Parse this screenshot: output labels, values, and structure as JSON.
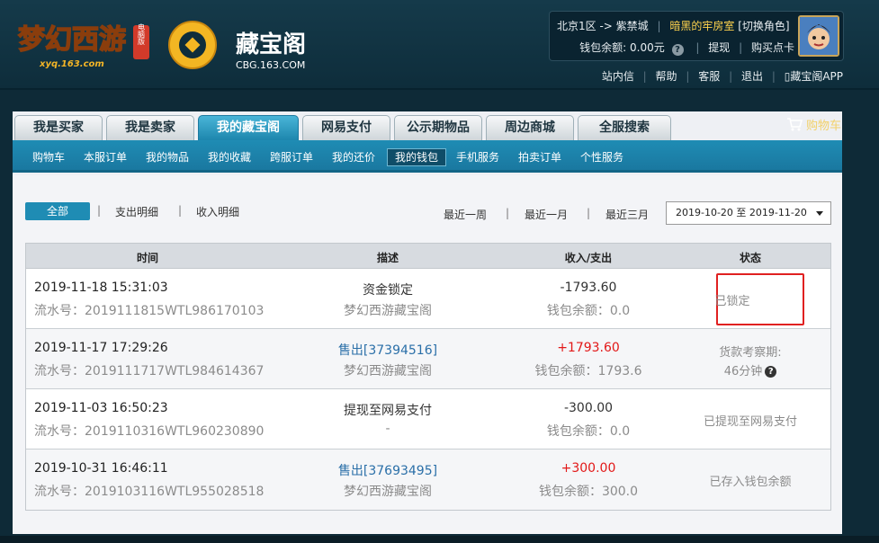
{
  "header": {
    "game_logo_text": "梦幻西游",
    "game_logo_badge": "电脑版",
    "game_logo_url": "xyq.163.com",
    "cbg_logo_text": "藏宝阁",
    "cbg_logo_url": "CBG.163.COM",
    "server": "北京1区 -> 紫禁城",
    "role_name": "暗黑的牢房室",
    "switch_role": "[切换角色]",
    "wallet_label": "钱包余额:",
    "wallet_value": "0.00元",
    "withdraw": "提现",
    "buy_card": "购买点卡",
    "top_links": [
      "站内信",
      "帮助",
      "客服",
      "退出",
      "藏宝阁APP"
    ]
  },
  "primary_nav": [
    "我是买家",
    "我是卖家",
    "我的藏宝阁",
    "网易支付",
    "公示期物品",
    "周边商城",
    "全服搜索"
  ],
  "cart": "购物车",
  "secondary_nav": [
    "购物车",
    "本服订单",
    "我的物品",
    "我的收藏",
    "跨服订单",
    "我的还价",
    "我的钱包",
    "手机服务",
    "拍卖订单",
    "个性服务"
  ],
  "filters": {
    "all": "全部",
    "expense": "支出明细",
    "income": "收入明细",
    "week": "最近一周",
    "month": "最近一月",
    "quarter": "最近三月",
    "date_range": "2019-10-20 至 2019-11-20"
  },
  "table": {
    "headers": [
      "时间",
      "描述",
      "收入/支出",
      "状态"
    ],
    "rows": [
      {
        "time": "2019-11-18 15:31:03",
        "serial": "流水号：2019111815WTL986170103",
        "desc": "资金锁定",
        "desc2": "梦幻西游藏宝阁",
        "amount": "-1793.60",
        "balance": "钱包余额：0.0",
        "status": "已锁定",
        "status2": ""
      },
      {
        "time": "2019-11-17 17:29:26",
        "serial": "流水号：2019111717WTL984614367",
        "desc": "售出[37394516]",
        "desc2": "梦幻西游藏宝阁",
        "amount": "+1793.60",
        "balance": "钱包余额：1793.6",
        "status": "货款考察期:",
        "status2": "46分钟"
      },
      {
        "time": "2019-11-03 16:50:23",
        "serial": "流水号：2019110316WTL960230890",
        "desc": "提现至网易支付",
        "desc2": "-",
        "amount": "-300.00",
        "balance": "钱包余额：0.0",
        "status": "已提现至网易支付",
        "status2": ""
      },
      {
        "time": "2019-10-31 16:46:11",
        "serial": "流水号：2019103116WTL955028518",
        "desc": "售出[37693495]",
        "desc2": "梦幻西游藏宝阁",
        "amount": "+300.00",
        "balance": "钱包余额：300.0",
        "status": "已存入钱包余额",
        "status2": ""
      }
    ]
  },
  "colors": {
    "accent": "#1f8cb4",
    "positive": "#e21818",
    "highlight_box": "#e02020",
    "role_name": "#ffd34d"
  }
}
